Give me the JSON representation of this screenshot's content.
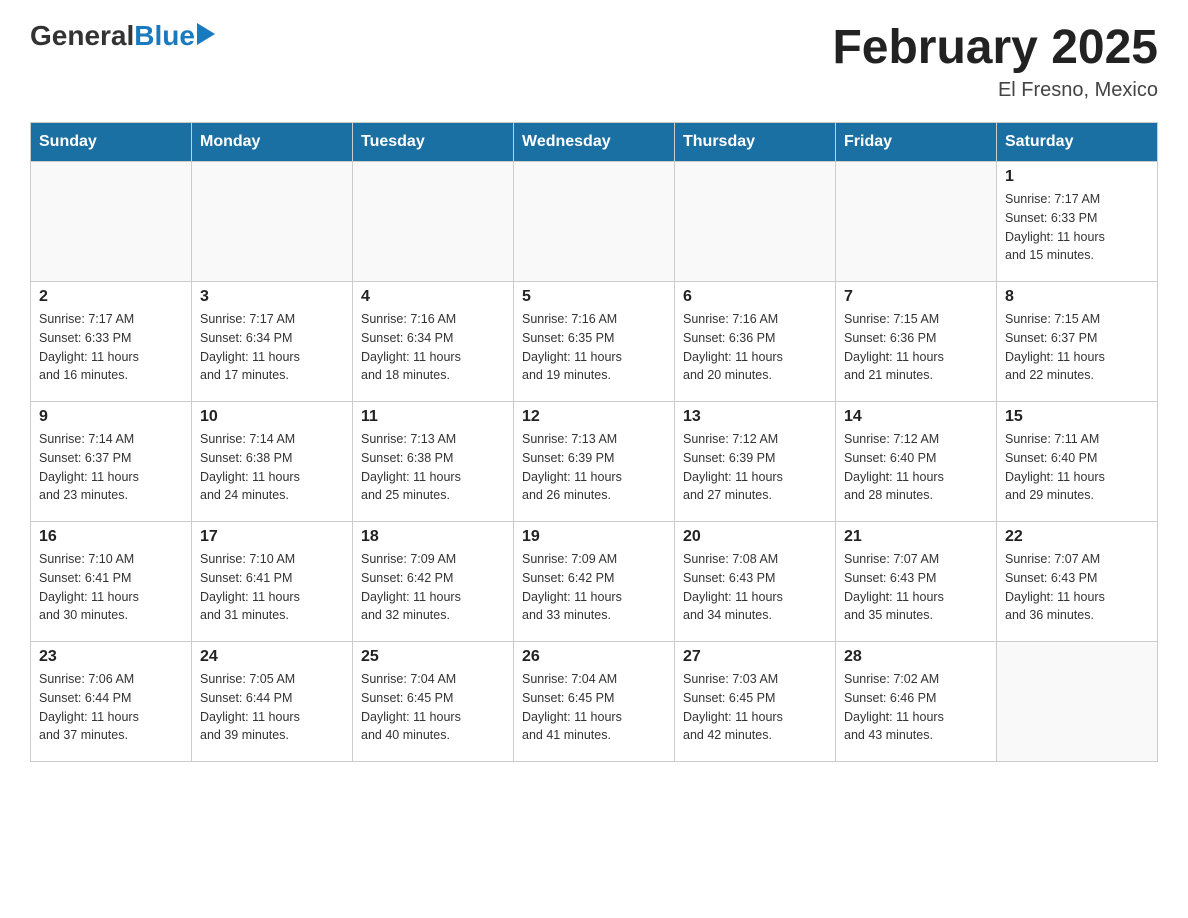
{
  "header": {
    "logo_general": "General",
    "logo_blue": "Blue",
    "month_title": "February 2025",
    "location": "El Fresno, Mexico"
  },
  "weekdays": [
    "Sunday",
    "Monday",
    "Tuesday",
    "Wednesday",
    "Thursday",
    "Friday",
    "Saturday"
  ],
  "weeks": [
    [
      {
        "day": "",
        "info": ""
      },
      {
        "day": "",
        "info": ""
      },
      {
        "day": "",
        "info": ""
      },
      {
        "day": "",
        "info": ""
      },
      {
        "day": "",
        "info": ""
      },
      {
        "day": "",
        "info": ""
      },
      {
        "day": "1",
        "info": "Sunrise: 7:17 AM\nSunset: 6:33 PM\nDaylight: 11 hours\nand 15 minutes."
      }
    ],
    [
      {
        "day": "2",
        "info": "Sunrise: 7:17 AM\nSunset: 6:33 PM\nDaylight: 11 hours\nand 16 minutes."
      },
      {
        "day": "3",
        "info": "Sunrise: 7:17 AM\nSunset: 6:34 PM\nDaylight: 11 hours\nand 17 minutes."
      },
      {
        "day": "4",
        "info": "Sunrise: 7:16 AM\nSunset: 6:34 PM\nDaylight: 11 hours\nand 18 minutes."
      },
      {
        "day": "5",
        "info": "Sunrise: 7:16 AM\nSunset: 6:35 PM\nDaylight: 11 hours\nand 19 minutes."
      },
      {
        "day": "6",
        "info": "Sunrise: 7:16 AM\nSunset: 6:36 PM\nDaylight: 11 hours\nand 20 minutes."
      },
      {
        "day": "7",
        "info": "Sunrise: 7:15 AM\nSunset: 6:36 PM\nDaylight: 11 hours\nand 21 minutes."
      },
      {
        "day": "8",
        "info": "Sunrise: 7:15 AM\nSunset: 6:37 PM\nDaylight: 11 hours\nand 22 minutes."
      }
    ],
    [
      {
        "day": "9",
        "info": "Sunrise: 7:14 AM\nSunset: 6:37 PM\nDaylight: 11 hours\nand 23 minutes."
      },
      {
        "day": "10",
        "info": "Sunrise: 7:14 AM\nSunset: 6:38 PM\nDaylight: 11 hours\nand 24 minutes."
      },
      {
        "day": "11",
        "info": "Sunrise: 7:13 AM\nSunset: 6:38 PM\nDaylight: 11 hours\nand 25 minutes."
      },
      {
        "day": "12",
        "info": "Sunrise: 7:13 AM\nSunset: 6:39 PM\nDaylight: 11 hours\nand 26 minutes."
      },
      {
        "day": "13",
        "info": "Sunrise: 7:12 AM\nSunset: 6:39 PM\nDaylight: 11 hours\nand 27 minutes."
      },
      {
        "day": "14",
        "info": "Sunrise: 7:12 AM\nSunset: 6:40 PM\nDaylight: 11 hours\nand 28 minutes."
      },
      {
        "day": "15",
        "info": "Sunrise: 7:11 AM\nSunset: 6:40 PM\nDaylight: 11 hours\nand 29 minutes."
      }
    ],
    [
      {
        "day": "16",
        "info": "Sunrise: 7:10 AM\nSunset: 6:41 PM\nDaylight: 11 hours\nand 30 minutes."
      },
      {
        "day": "17",
        "info": "Sunrise: 7:10 AM\nSunset: 6:41 PM\nDaylight: 11 hours\nand 31 minutes."
      },
      {
        "day": "18",
        "info": "Sunrise: 7:09 AM\nSunset: 6:42 PM\nDaylight: 11 hours\nand 32 minutes."
      },
      {
        "day": "19",
        "info": "Sunrise: 7:09 AM\nSunset: 6:42 PM\nDaylight: 11 hours\nand 33 minutes."
      },
      {
        "day": "20",
        "info": "Sunrise: 7:08 AM\nSunset: 6:43 PM\nDaylight: 11 hours\nand 34 minutes."
      },
      {
        "day": "21",
        "info": "Sunrise: 7:07 AM\nSunset: 6:43 PM\nDaylight: 11 hours\nand 35 minutes."
      },
      {
        "day": "22",
        "info": "Sunrise: 7:07 AM\nSunset: 6:43 PM\nDaylight: 11 hours\nand 36 minutes."
      }
    ],
    [
      {
        "day": "23",
        "info": "Sunrise: 7:06 AM\nSunset: 6:44 PM\nDaylight: 11 hours\nand 37 minutes."
      },
      {
        "day": "24",
        "info": "Sunrise: 7:05 AM\nSunset: 6:44 PM\nDaylight: 11 hours\nand 39 minutes."
      },
      {
        "day": "25",
        "info": "Sunrise: 7:04 AM\nSunset: 6:45 PM\nDaylight: 11 hours\nand 40 minutes."
      },
      {
        "day": "26",
        "info": "Sunrise: 7:04 AM\nSunset: 6:45 PM\nDaylight: 11 hours\nand 41 minutes."
      },
      {
        "day": "27",
        "info": "Sunrise: 7:03 AM\nSunset: 6:45 PM\nDaylight: 11 hours\nand 42 minutes."
      },
      {
        "day": "28",
        "info": "Sunrise: 7:02 AM\nSunset: 6:46 PM\nDaylight: 11 hours\nand 43 minutes."
      },
      {
        "day": "",
        "info": ""
      }
    ]
  ]
}
